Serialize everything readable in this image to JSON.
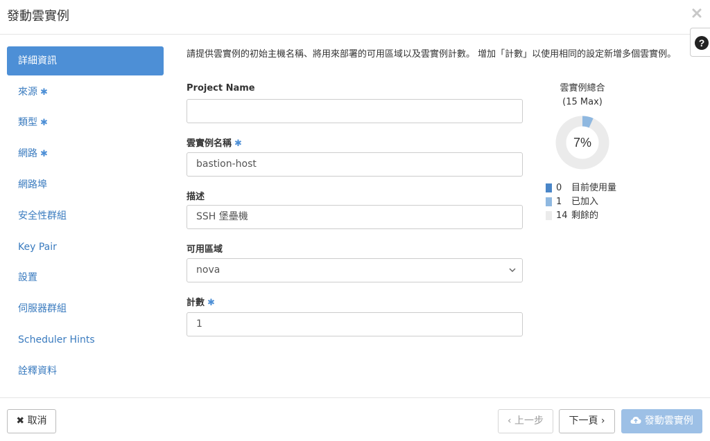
{
  "header": {
    "title": "發動雲實例",
    "close_label": "×"
  },
  "help": {
    "label": "?"
  },
  "sidebar": {
    "items": [
      {
        "label": "詳細資訊",
        "required": false,
        "active": true
      },
      {
        "label": "來源",
        "required": true,
        "active": false
      },
      {
        "label": "類型",
        "required": true,
        "active": false
      },
      {
        "label": "網路",
        "required": true,
        "active": false
      },
      {
        "label": "網路埠",
        "required": false,
        "active": false
      },
      {
        "label": "安全性群組",
        "required": false,
        "active": false
      },
      {
        "label": "Key Pair",
        "required": false,
        "active": false
      },
      {
        "label": "設置",
        "required": false,
        "active": false
      },
      {
        "label": "伺服器群組",
        "required": false,
        "active": false
      },
      {
        "label": "Scheduler Hints",
        "required": false,
        "active": false
      },
      {
        "label": "詮釋資料",
        "required": false,
        "active": false
      }
    ],
    "required_marker": "✱"
  },
  "intro": "請提供雲實例的初始主機名稱、將用來部署的可用區域以及雲實例計數。 增加「計數」以使用相同的設定新增多個雲實例。",
  "form": {
    "project_name": {
      "label": "Project Name",
      "value": ""
    },
    "instance_name": {
      "label": "雲實例名稱",
      "value": "bastion-host",
      "required": true
    },
    "description": {
      "label": "描述",
      "value": "SSH 堡壘機"
    },
    "availability_zone": {
      "label": "可用區域",
      "value": "nova"
    },
    "count": {
      "label": "計數",
      "value": "1",
      "required": true
    }
  },
  "quota": {
    "title": "雲實例總合",
    "max_label": "(15 Max)",
    "percent_label": "7%",
    "used": 0,
    "added": 1,
    "remaining": 14,
    "max": 15,
    "legend": [
      {
        "count": "0",
        "label": "目前使用量",
        "color": "#4a86c8"
      },
      {
        "count": "1",
        "label": "已加入",
        "color": "#8fb8e0"
      },
      {
        "count": "14",
        "label": "剩餘的",
        "color": "#ebebeb"
      }
    ],
    "ring_color": "#ebebeb",
    "added_color": "#8fb8e0"
  },
  "footer": {
    "cancel_label": "取消",
    "back_label": "‹ 上一步",
    "next_label": "下一頁 ›",
    "launch_label": "發動雲實例"
  },
  "colors": {
    "accent": "#4d8fd6",
    "link": "#3a7bbf",
    "primary_disabled": "#9dc0e6"
  }
}
